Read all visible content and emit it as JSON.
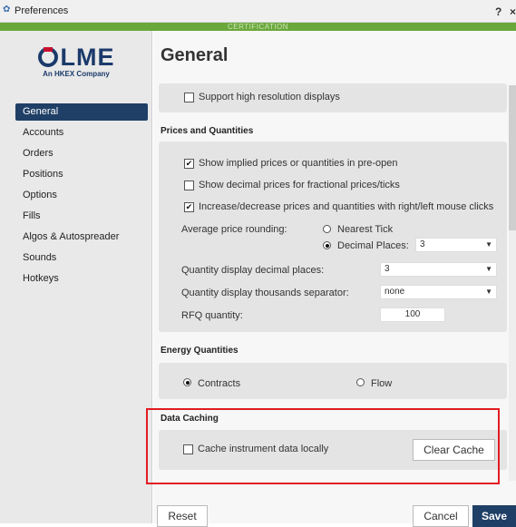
{
  "window": {
    "title": "Preferences",
    "help": "?",
    "close": "×",
    "app_icon": "gear-icon"
  },
  "environment_banner": "CERTIFICATION",
  "logo": {
    "name": "LME",
    "tagline": "An HKEX Company"
  },
  "sidebar": {
    "items": [
      {
        "label": "General",
        "active": true
      },
      {
        "label": "Accounts"
      },
      {
        "label": "Orders"
      },
      {
        "label": "Positions"
      },
      {
        "label": "Options"
      },
      {
        "label": "Fills"
      },
      {
        "label": "Algos & Autospreader"
      },
      {
        "label": "Sounds"
      },
      {
        "label": "Hotkeys"
      }
    ]
  },
  "main": {
    "title": "General",
    "display": {
      "high_res_label": "Support high resolution displays",
      "high_res_checked": false
    },
    "prices_quantities": {
      "heading": "Prices and Quantities",
      "implied_label": "Show implied prices or quantities in pre-open",
      "implied_checked": true,
      "decimal_label": "Show decimal prices for fractional prices/ticks",
      "decimal_checked": false,
      "mouse_label": "Increase/decrease prices and quantities with right/left mouse clicks",
      "mouse_checked": true,
      "rounding_label": "Average price rounding:",
      "rounding_nearest": "Nearest Tick",
      "rounding_decimal": "Decimal Places:",
      "rounding_selected": "decimal",
      "rounding_decimal_value": "3",
      "qty_decimal_label": "Quantity display decimal places:",
      "qty_decimal_value": "3",
      "thousands_label": "Quantity display thousands separator:",
      "thousands_value": "none",
      "rfq_label": "RFQ quantity:",
      "rfq_value": "100"
    },
    "energy": {
      "heading": "Energy Quantities",
      "contracts": "Contracts",
      "flow": "Flow",
      "selected": "contracts"
    },
    "caching": {
      "heading": "Data Caching",
      "cache_label": "Cache instrument data locally",
      "cache_checked": false,
      "clear_button": "Clear Cache"
    }
  },
  "footer": {
    "reset": "Reset",
    "cancel": "Cancel",
    "save": "Save"
  },
  "colors": {
    "accent": "#1f3f66",
    "env_banner": "#6aa83c",
    "highlight": "#e31b23"
  }
}
